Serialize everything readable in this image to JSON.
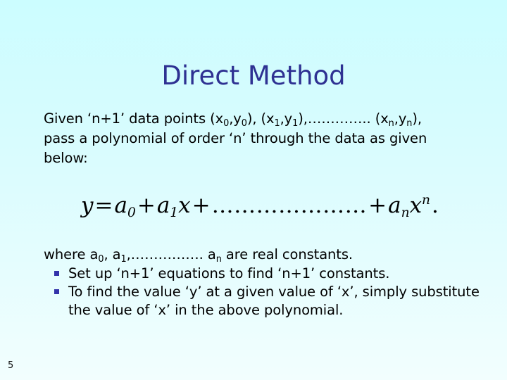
{
  "slide": {
    "title": "Direct Method",
    "title_color": "#2E3192",
    "background_top_color": "#CCFDFF",
    "background_bottom_color": "#F2FEFE",
    "slide_number": "5",
    "intro": {
      "line1_a": "Given ‘n+1’ data points (x",
      "line1_sub1": "0",
      "line1_b": ",y",
      "line1_sub2": "0",
      "line1_c": "), (x",
      "line1_sub3": "1",
      "line1_d": ",y",
      "line1_sub4": "1",
      "line1_e": "),………….. (x",
      "line1_sub5": "n",
      "line1_f": ",y",
      "line1_sub6": "n",
      "line1_g": "),",
      "line2": "pass a polynomial of order ‘n’ through the data as given",
      "line3": " below:"
    },
    "equation": {
      "lhs": "y",
      "equals": "=",
      "term1_base": "a",
      "term1_sub": "0",
      "plus1": "+",
      "term2_base": "a",
      "term2_sub": "1",
      "term2_var": "x",
      "plus2": "+",
      "dots": "…………………",
      "plus3": "+",
      "term3_base": "a",
      "term3_sub": "n",
      "term3_var": "x",
      "term3_sup": "n",
      "period": ".",
      "plain_text": "y = a0 + a1x + ………………… + an x^n ."
    },
    "where_line": {
      "a": "where a",
      "sub1": "0",
      "b": ", a",
      "sub2": "1",
      "c": ",……………. a",
      "sub3": "n",
      "d": " are real constants."
    },
    "bullets": [
      {
        "marker": "square-bullet",
        "text": "Set up ‘n+1’ equations to find ‘n+1’ constants.",
        "marker_color": "#3333AA"
      },
      {
        "marker": "square-bullet",
        "text": "To find the value ‘y’ at a given value of ‘x’, simply substitute the value of ‘x’ in the above polynomial.",
        "marker_color": "#3333AA"
      }
    ]
  }
}
